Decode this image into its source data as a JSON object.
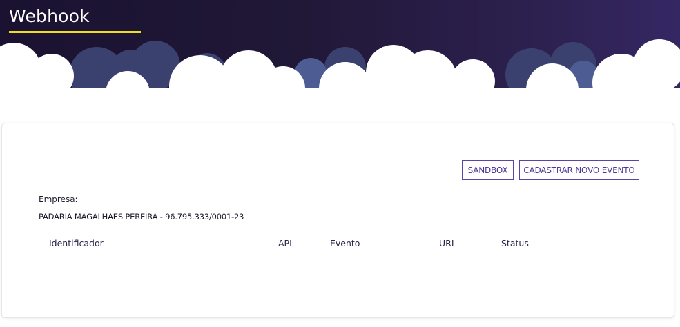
{
  "header": {
    "title": "Webhook",
    "accent_color": "#f2dd1b",
    "background_color": "#1f1636"
  },
  "card": {
    "buttons": {
      "sandbox": "SANDBOX",
      "new_event": "CADASTRAR NOVO EVENTO"
    },
    "company_label": "Empresa:",
    "company_value": "PADARIA MAGALHAES PEREIRA - 96.795.333/0001-23",
    "table": {
      "columns": [
        "Identificador",
        "API",
        "Evento",
        "URL",
        "Status"
      ],
      "rows": []
    }
  },
  "colors": {
    "primary": "#4a3797",
    "cloud_back": "#3a3f6e",
    "cloud_front": "#ffffff"
  }
}
